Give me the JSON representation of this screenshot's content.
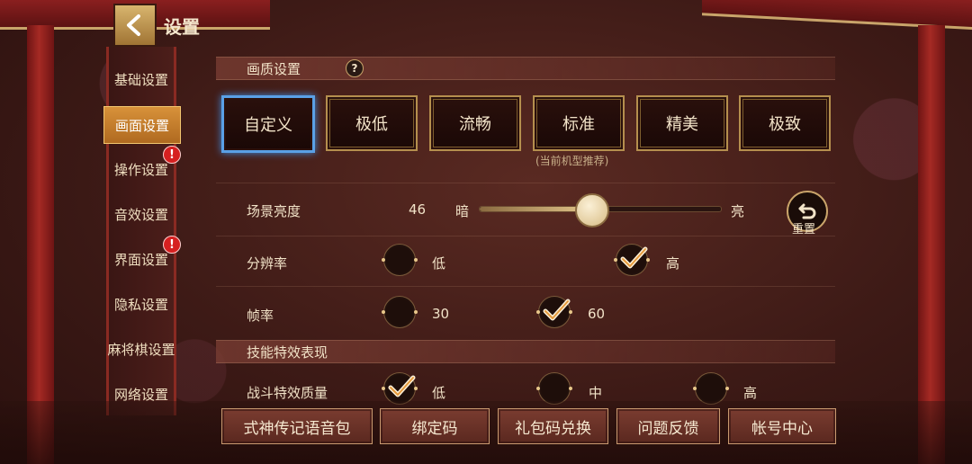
{
  "header": {
    "title": "设置",
    "back_icon": "back-arrow-icon"
  },
  "sidebar": {
    "items": [
      {
        "label": "基础设置",
        "active": false,
        "badge": ""
      },
      {
        "label": "画面设置",
        "active": true,
        "badge": ""
      },
      {
        "label": "操作设置",
        "active": false,
        "badge": "!"
      },
      {
        "label": "音效设置",
        "active": false,
        "badge": ""
      },
      {
        "label": "界面设置",
        "active": false,
        "badge": "!"
      },
      {
        "label": "隐私设置",
        "active": false,
        "badge": ""
      },
      {
        "label": "麻将棋设置",
        "active": false,
        "badge": ""
      },
      {
        "label": "网络设置",
        "active": false,
        "badge": ""
      }
    ]
  },
  "quality": {
    "section_title": "画质设置",
    "help": "?",
    "presets": [
      "自定义",
      "极低",
      "流畅",
      "标准",
      "精美",
      "极致"
    ],
    "selected": "自定义",
    "recommend_note": "(当前机型推荐)"
  },
  "brightness": {
    "label": "场景亮度",
    "value": "46",
    "min_label": "暗",
    "max_label": "亮",
    "fraction": 0.46,
    "reset_label": "重置"
  },
  "resolution": {
    "label": "分辨率",
    "options": [
      "低",
      "高"
    ],
    "selected": "高"
  },
  "framerate": {
    "label": "帧率",
    "options": [
      "30",
      "60"
    ],
    "selected": "60"
  },
  "skill_effects": {
    "section_title": "技能特效表现",
    "battle_label": "战斗特效质量",
    "options": [
      "低",
      "中",
      "高"
    ],
    "selected": "低"
  },
  "bottom": {
    "buttons": [
      "式神传记语音包",
      "绑定码",
      "礼包码兑换",
      "问题反馈",
      "帐号中心"
    ]
  },
  "colors": {
    "accent_gold": "#c9a46a",
    "selected_blue": "#5aa0e6",
    "active_orange": "#c8802e"
  }
}
